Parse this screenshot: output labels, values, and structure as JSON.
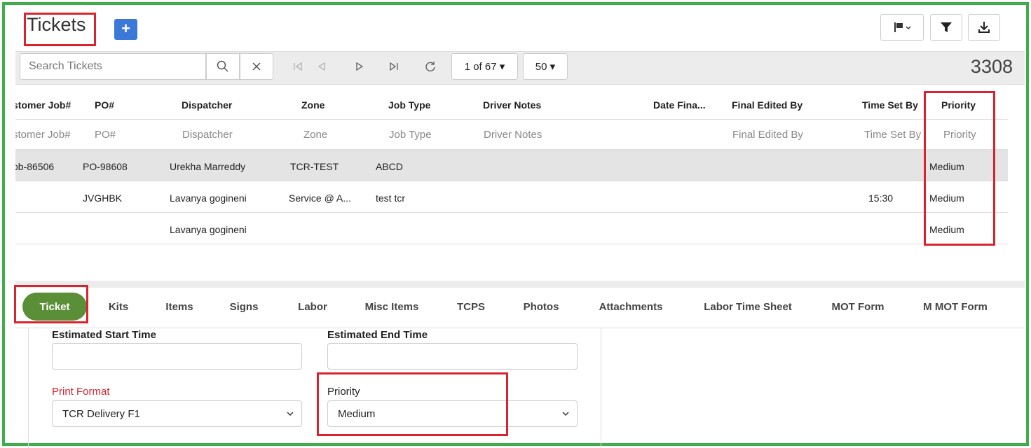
{
  "header": {
    "title": "Tickets",
    "add_label": "+"
  },
  "toolbar": {
    "search_placeholder": "Search Tickets",
    "page_indicator": "1 of 67 ▾",
    "page_size": "50 ▾",
    "total_count": "3308"
  },
  "grid": {
    "headers": [
      "stomer Job#",
      "PO#",
      "Dispatcher",
      "Zone",
      "Job Type",
      "Driver Notes",
      "Date Fina...",
      "Final Edited By",
      "Time Set By",
      "Priority"
    ],
    "filters": [
      "stomer Job#",
      "PO#",
      "Dispatcher",
      "Zone",
      "Job Type",
      "Driver Notes",
      "",
      "Final Edited By",
      "Time Set By",
      "Priority"
    ],
    "rows": [
      {
        "job": "ob-86506",
        "po": "PO-98608",
        "dispatcher": "Urekha Marreddy",
        "zone": "TCR-TEST",
        "job_type": "ABCD",
        "time_set_by": "",
        "priority": "Medium"
      },
      {
        "job": "",
        "po": "JVGHBK",
        "dispatcher": "Lavanya gogineni",
        "zone": "Service @ A...",
        "job_type": "test tcr",
        "time_set_by": "15:30",
        "priority": "Medium"
      },
      {
        "job": "",
        "po": "",
        "dispatcher": "Lavanya gogineni",
        "zone": "",
        "job_type": "",
        "time_set_by": "",
        "priority": "Medium"
      }
    ]
  },
  "tabs": [
    "Ticket",
    "Kits",
    "Items",
    "Signs",
    "Labor",
    "Misc Items",
    "TCPS",
    "Photos",
    "Attachments",
    "Labor Time Sheet",
    "MOT Form",
    "M MOT Form"
  ],
  "form": {
    "est_start_label": "Estimated Start Time",
    "est_end_label": "Estimated End Time",
    "print_format_label": "Print Format",
    "print_format_value": "TCR Delivery F1",
    "priority_label": "Priority",
    "priority_value": "Medium"
  },
  "colors": {
    "accent_green": "#5a8f38",
    "frame_green": "#3fae49",
    "highlight_red": "#d9232e",
    "required_red": "#d9232e",
    "button_blue": "#3c78d8"
  }
}
